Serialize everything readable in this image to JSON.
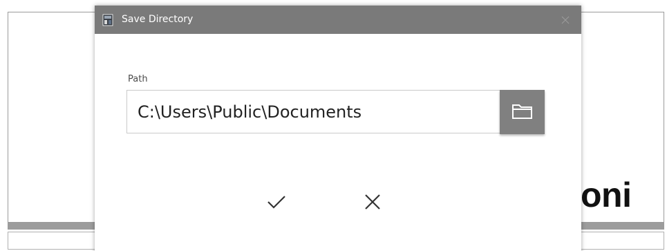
{
  "background": {
    "partial_text": "oni"
  },
  "dialog": {
    "title": "Save Directory",
    "app_icon": "app-icon",
    "close_icon": "close-icon",
    "path_label": "Path",
    "path_value": "C:\\Users\\Public\\Documents",
    "browse_icon": "folder-icon",
    "ok_icon": "checkmark-icon",
    "cancel_icon": "close-icon"
  },
  "colors": {
    "titlebar": "#7a7a7a",
    "browse_button": "#808080",
    "text": "#222222"
  }
}
